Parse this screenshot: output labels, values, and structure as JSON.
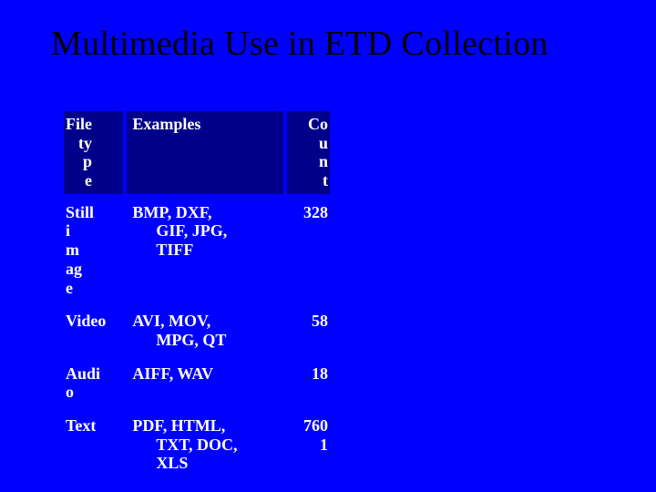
{
  "title": "Multimedia Use in ETD Collection",
  "table": {
    "headers": {
      "type_lines": [
        "File",
        "ty",
        "p",
        "e"
      ],
      "examples": "Examples",
      "count_lines": [
        "Co",
        "u",
        "n",
        "t"
      ]
    },
    "rows": [
      {
        "type_lines": [
          "Still",
          "i",
          "m",
          "ag",
          "e"
        ],
        "examples_lines": [
          "BMP, DXF,",
          "GIF, JPG,",
          "TIFF"
        ],
        "count_lines": [
          "328"
        ]
      },
      {
        "type_lines": [
          "Video"
        ],
        "examples_lines": [
          "AVI, MOV,",
          "MPG, QT"
        ],
        "count_lines": [
          "58"
        ]
      },
      {
        "type_lines": [
          "Audi",
          "o"
        ],
        "examples_lines": [
          "AIFF, WAV"
        ],
        "count_lines": [
          "18"
        ]
      },
      {
        "type_lines": [
          "Text"
        ],
        "examples_lines": [
          "PDF, HTML,",
          "TXT, DOC,",
          "XLS"
        ],
        "count_lines": [
          "760",
          "1"
        ]
      }
    ]
  },
  "chart_data": {
    "type": "table",
    "title": "Multimedia Use in ETD Collection",
    "columns": [
      "File type",
      "Examples",
      "Count"
    ],
    "rows": [
      {
        "File type": "Still image",
        "Examples": "BMP, DXF, GIF, JPG, TIFF",
        "Count": 328
      },
      {
        "File type": "Video",
        "Examples": "AVI, MOV, MPG, QT",
        "Count": 58
      },
      {
        "File type": "Audio",
        "Examples": "AIFF, WAV",
        "Count": 18
      },
      {
        "File type": "Text",
        "Examples": "PDF, HTML, TXT, DOC, XLS",
        "Count": 7601
      }
    ]
  }
}
